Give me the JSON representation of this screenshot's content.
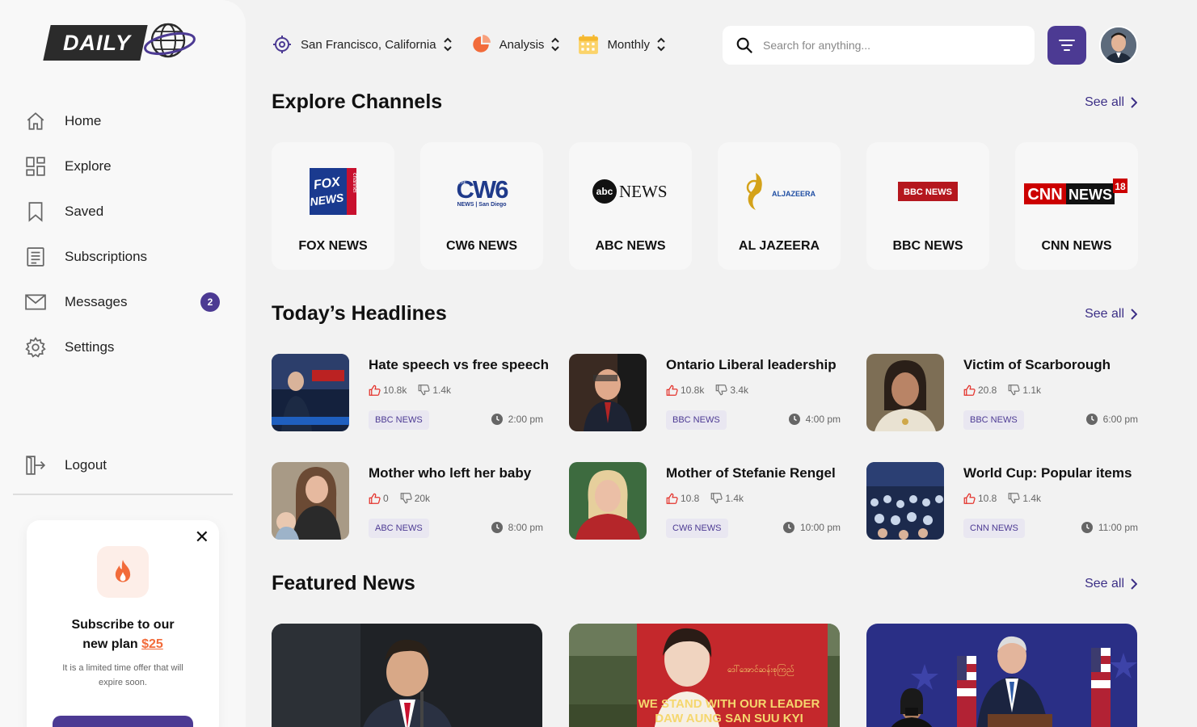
{
  "brand": {
    "logo_text": "DAILY"
  },
  "sidebar": {
    "items": [
      {
        "label": "Home",
        "icon": "home-icon"
      },
      {
        "label": "Explore",
        "icon": "grid-icon"
      },
      {
        "label": "Saved",
        "icon": "bookmark-icon"
      },
      {
        "label": "Subscriptions",
        "icon": "document-icon"
      },
      {
        "label": "Messages",
        "icon": "mail-icon",
        "badge": "2"
      },
      {
        "label": "Settings",
        "icon": "gear-icon"
      }
    ],
    "logout": "Logout"
  },
  "promo": {
    "title_line1": "Subscribe to our",
    "title_line2": "new plan",
    "price": "$25",
    "description": "It is a limited time offer that will expire soon."
  },
  "topbar": {
    "location": "San Francisco, California",
    "analysis": "Analysis",
    "period": "Monthly",
    "search_placeholder": "Search for anything..."
  },
  "sections": {
    "channels_title": "Explore Channels",
    "headlines_title": "Today’s Headlines",
    "featured_title": "Featured News",
    "see_all": "See all"
  },
  "channels": [
    {
      "name": "FOX NEWS"
    },
    {
      "name": "CW6 NEWS"
    },
    {
      "name": "ABC NEWS"
    },
    {
      "name": "AL JAZEERA"
    },
    {
      "name": "BBC NEWS"
    },
    {
      "name": "CNN NEWS"
    }
  ],
  "channel_logos": {
    "fox_line1": "FOX",
    "fox_line2": "NEWS",
    "fox_side": "channel",
    "cw6_main": "CW6",
    "cw6_small": "THE",
    "cw6_sub": "NEWS | San Diego",
    "abc_mark": "abc",
    "abc_word": "NEWS",
    "aljazeera_word": "ALJAZEERA",
    "bbc_word": "BBC NEWS",
    "cnn_word": "CNN",
    "cnn_news": "NEWS",
    "cnn_num": "18"
  },
  "headlines": [
    {
      "title": "Hate speech vs free speech",
      "likes": "10.8k",
      "dislikes": "1.4k",
      "source": "BBC NEWS",
      "time": "2:00 pm"
    },
    {
      "title": "Ontario Liberal leadership",
      "likes": "10.8k",
      "dislikes": "3.4k",
      "source": "BBC NEWS",
      "time": "4:00 pm"
    },
    {
      "title": "Victim of Scarborough",
      "likes": "20.8",
      "dislikes": "1.1k",
      "source": "BBC NEWS",
      "time": "6:00 pm"
    },
    {
      "title": "Mother who left her baby",
      "likes": "0",
      "dislikes": "20k",
      "source": "ABC NEWS",
      "time": "8:00 pm"
    },
    {
      "title": "Mother of Stefanie Rengel",
      "likes": "10.8",
      "dislikes": "1.4k",
      "source": "CW6 NEWS",
      "time": "10:00 pm"
    },
    {
      "title": "World Cup: Popular items",
      "likes": "10.8",
      "dislikes": "1.4k",
      "source": "CNN NEWS",
      "time": "11:00 pm"
    }
  ],
  "featured_banner": {
    "line1": "WE STAND WITH OUR LEADER",
    "line2": "DAW AUNG SAN SUU KYI"
  },
  "colors": {
    "accent": "#4c3a93",
    "orange": "#f26b3a",
    "like": "#e4322b"
  }
}
